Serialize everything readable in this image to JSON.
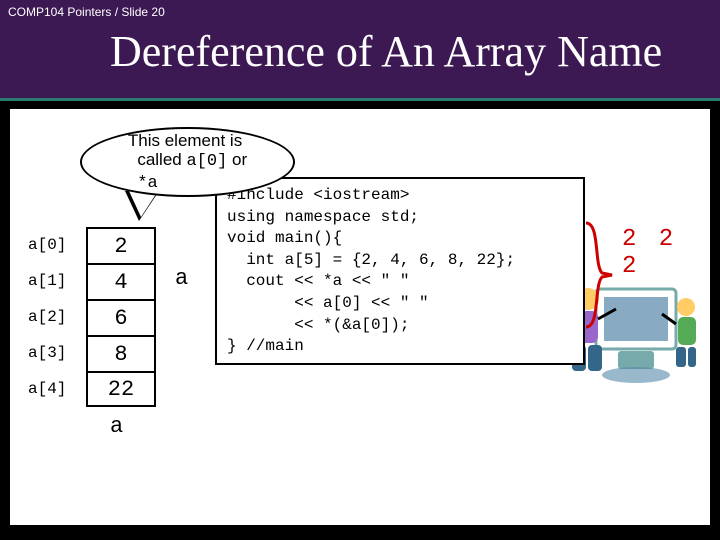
{
  "slide_header": "COMP104 Pointers / Slide 20",
  "title": "Dereference of An Array Name",
  "callout": {
    "line1": "This element is",
    "line2_pre": "called ",
    "line2_code": "a[0]",
    "line2_post": " or",
    "line3_code": "*a"
  },
  "array": {
    "rows": [
      {
        "label": "a[0]",
        "value": "2"
      },
      {
        "label": "a[1]",
        "value": "4"
      },
      {
        "label": "a[2]",
        "value": "6"
      },
      {
        "label": "a[3]",
        "value": "8"
      },
      {
        "label": "a[4]",
        "value": "22"
      }
    ],
    "pointer_label_right": "a",
    "pointer_label_bottom": "a"
  },
  "code": "#include <iostream>\nusing namespace std;\nvoid main(){\n  int a[5] = {2, 4, 6, 8, 22};\n  cout << *a << \" \"\n       << a[0] << \" \"\n       << *(&a[0]);\n} //main",
  "output": "2 2 2"
}
